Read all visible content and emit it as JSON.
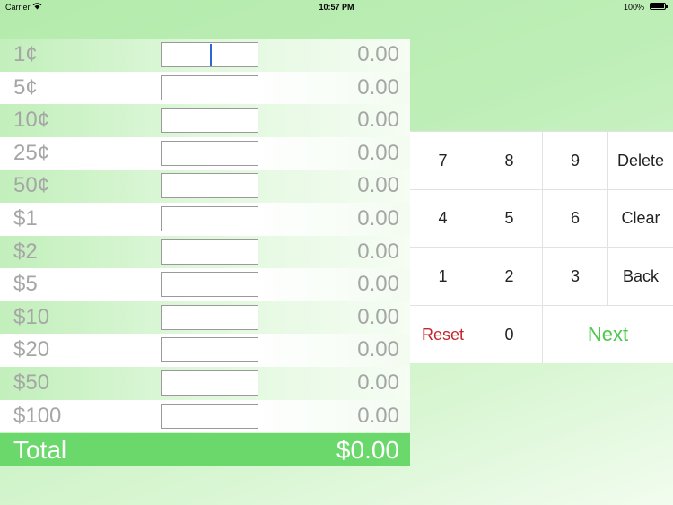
{
  "status_bar": {
    "carrier": "Carrier",
    "time": "10:57 PM",
    "battery": "100%"
  },
  "denominations": [
    {
      "label": "1¢",
      "count": "",
      "amount": "0.00"
    },
    {
      "label": "5¢",
      "count": "",
      "amount": "0.00"
    },
    {
      "label": "10¢",
      "count": "",
      "amount": "0.00"
    },
    {
      "label": "25¢",
      "count": "",
      "amount": "0.00"
    },
    {
      "label": "50¢",
      "count": "",
      "amount": "0.00"
    },
    {
      "label": "$1",
      "count": "",
      "amount": "0.00"
    },
    {
      "label": "$2",
      "count": "",
      "amount": "0.00"
    },
    {
      "label": "$5",
      "count": "",
      "amount": "0.00"
    },
    {
      "label": "$10",
      "count": "",
      "amount": "0.00"
    },
    {
      "label": "$20",
      "count": "",
      "amount": "0.00"
    },
    {
      "label": "$50",
      "count": "",
      "amount": "0.00"
    },
    {
      "label": "$100",
      "count": "",
      "amount": "0.00"
    }
  ],
  "total": {
    "label": "Total",
    "amount": "$0.00"
  },
  "keypad": {
    "keys": [
      "7",
      "8",
      "9",
      "Delete",
      "4",
      "5",
      "6",
      "Clear",
      "1",
      "2",
      "3",
      "Back",
      "Reset",
      "0",
      "Next"
    ]
  },
  "colors": {
    "total_bar": "#6ad86a",
    "reset": "#c4262e",
    "next": "#4cc94c",
    "cursor": "#2f66d6"
  }
}
